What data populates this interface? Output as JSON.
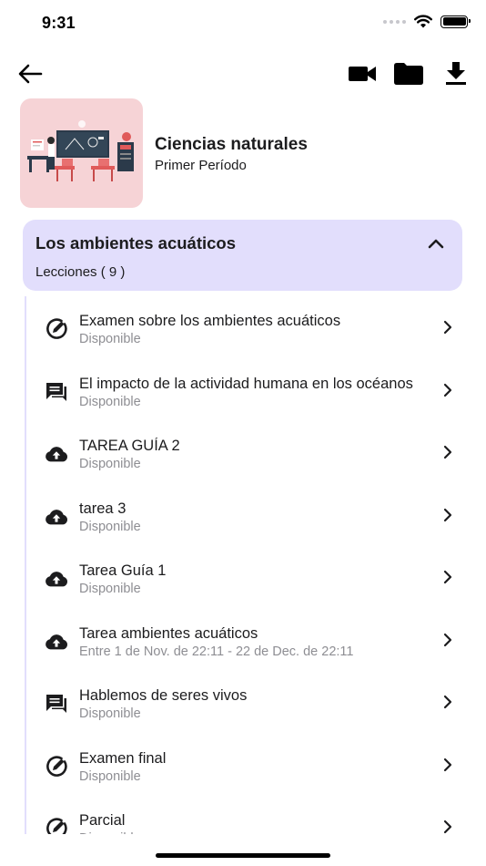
{
  "status_bar": {
    "time": "9:31"
  },
  "course": {
    "title": "Ciencias naturales",
    "period": "Primer Período"
  },
  "unit": {
    "title": "Los ambientes acuáticos",
    "lessons_label": "Lecciones ( 9 )",
    "expanded": true
  },
  "lessons": [
    {
      "icon": "exam-icon",
      "title": "Examen  sobre los ambientes acuáticos",
      "status": "Disponible"
    },
    {
      "icon": "forum-icon",
      "title": "El impacto de la actividad humana en los océanos",
      "status": "Disponible"
    },
    {
      "icon": "cloud-upload-icon",
      "title": "TAREA GUÍA 2",
      "status": "Disponible"
    },
    {
      "icon": "cloud-upload-icon",
      "title": "tarea 3",
      "status": "Disponible"
    },
    {
      "icon": "cloud-upload-icon",
      "title": "Tarea Guía 1",
      "status": "Disponible"
    },
    {
      "icon": "cloud-upload-icon",
      "title": "Tarea ambientes acuáticos",
      "status": "Entre 1 de Nov. de  22:11 - 22 de Dec. de  22:11"
    },
    {
      "icon": "forum-icon",
      "title": "Hablemos de seres vivos",
      "status": "Disponible"
    },
    {
      "icon": "exam-icon",
      "title": "Examen final",
      "status": "Disponible"
    },
    {
      "icon": "exam-icon",
      "title": "Parcial",
      "status": "Disponible"
    }
  ],
  "colors": {
    "accent_bg": "#e2defc",
    "course_image_bg": "#f6d3d6",
    "text_primary": "#1c1c1e",
    "text_secondary": "#8e8e93"
  }
}
